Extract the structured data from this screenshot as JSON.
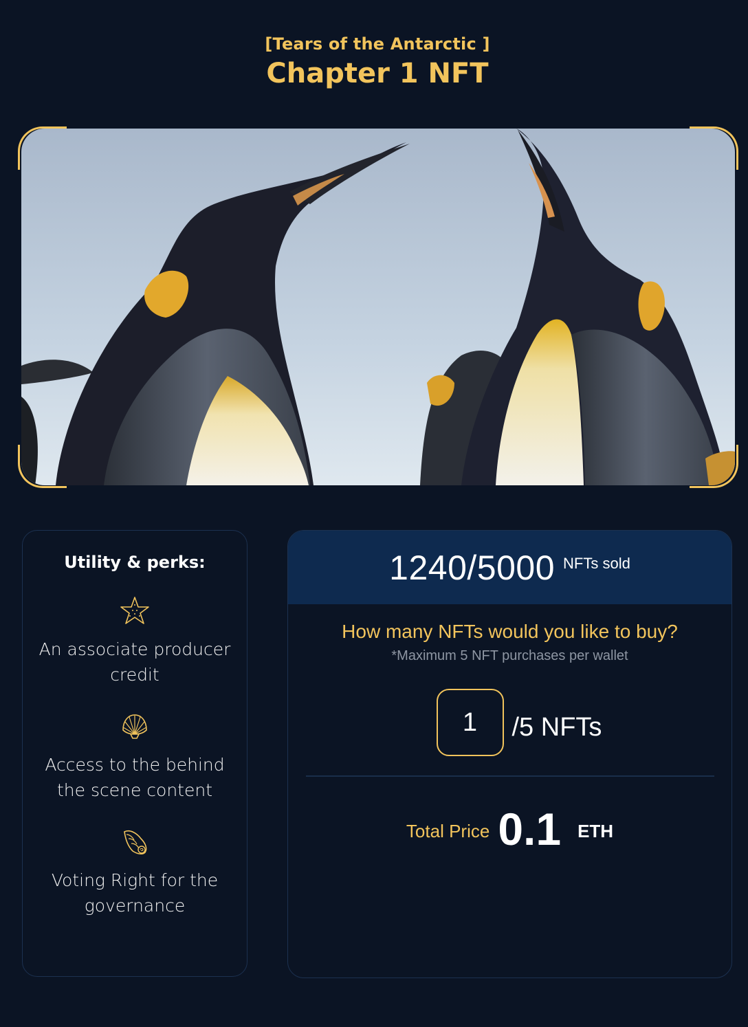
{
  "header": {
    "subtitle": "[Tears of the Antarctic ]",
    "title": "Chapter 1 NFT"
  },
  "hero": {
    "image": "king-penguins-photo"
  },
  "perks": {
    "title": "Utility & perks:",
    "items": [
      {
        "icon": "starfish-icon",
        "text": "An associate producer credit"
      },
      {
        "icon": "scallop-shell-icon",
        "text": "Access to the behind the scene content"
      },
      {
        "icon": "conch-shell-icon",
        "text": "Voting Right for the governance"
      }
    ]
  },
  "purchase": {
    "sold": "1240/5000",
    "sold_label": "NFTs sold",
    "question": "How many NFTs would you like to buy?",
    "max_note": "*Maximum 5 NFT purchases per wallet",
    "quantity": "1",
    "quantity_max": "/5 NFTs",
    "total_label": "Total Price",
    "total_value": "0.1",
    "currency": "ETH"
  },
  "colors": {
    "background": "#0b1424",
    "accent": "#f2c45c",
    "header_panel": "#0e2a4f",
    "border": "#1c3150"
  }
}
